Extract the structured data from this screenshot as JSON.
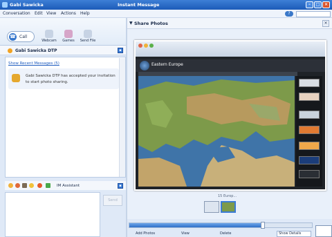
{
  "window": {
    "app_title": "Gabi Sawicka",
    "title": "Instant Message"
  },
  "menu": [
    "Conversation",
    "Edit",
    "View",
    "Actions",
    "Help"
  ],
  "toolbar": {
    "call_label": "Call",
    "buttons": [
      "Webcam",
      "Games",
      "Send File"
    ]
  },
  "contact": {
    "name": "Gabi Sawicka DTP",
    "status": "away"
  },
  "chat": {
    "recent_link": "Show Recent Messages (5)",
    "notice": "Gabi Sawicka DTP has accepted your invitation to start photo sharing."
  },
  "compose": {
    "emoticon_label": "IM Assistant",
    "send_label": "Send"
  },
  "share": {
    "title": "Share Photos",
    "caption": "15 Europ...",
    "site_title": "Eastern Europe"
  },
  "bottom": {
    "items": [
      "Add Photos",
      "View",
      "Delete"
    ],
    "dropdown": "Show Details"
  },
  "colors": {
    "titlebar": "#1c5bb8",
    "accent": "#3a7bd5",
    "status_away": "#f2a323",
    "map_land": "#7d9a4a",
    "map_sea": "#3f74a8"
  },
  "progress": {
    "position_fraction": 0.73
  }
}
